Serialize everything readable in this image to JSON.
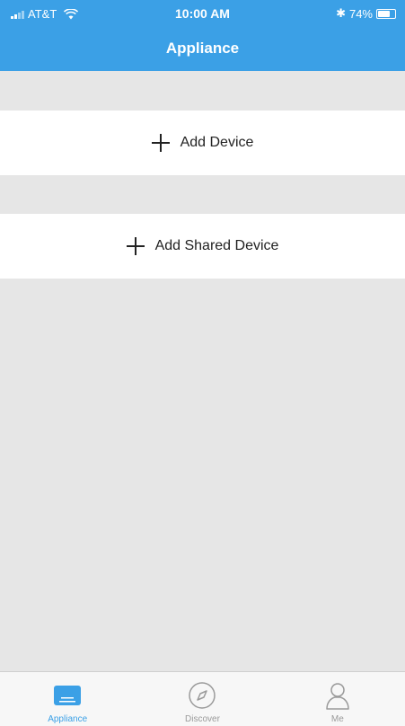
{
  "status_bar": {
    "carrier": "AT&T",
    "time": "10:00 AM",
    "bluetooth": "✱",
    "battery": "74%",
    "battery_level": 0.74
  },
  "header": {
    "title": "Appliance"
  },
  "main": {
    "add_device_label": "Add Device",
    "add_shared_label": "Add Shared Device"
  },
  "tabbar": {
    "tabs": [
      {
        "label": "Appliance",
        "icon": "appliance-icon",
        "active": true
      },
      {
        "label": "Discover",
        "icon": "compass-icon",
        "active": false
      },
      {
        "label": "Me",
        "icon": "person-icon",
        "active": false
      }
    ]
  },
  "colors": {
    "accent": "#3ba0e6",
    "background": "#e6e6e6",
    "inactive_tab": "#9a9a9a"
  }
}
